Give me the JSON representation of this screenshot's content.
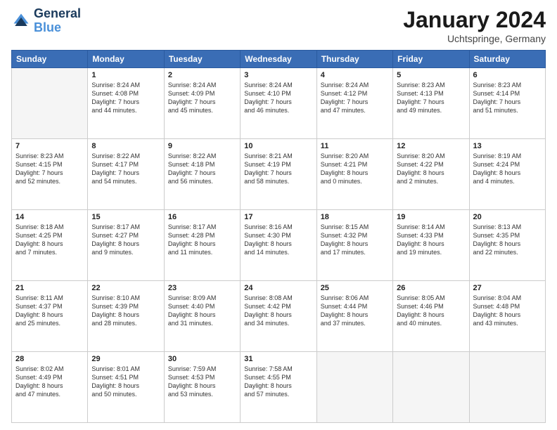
{
  "header": {
    "logo_line1": "General",
    "logo_line2": "Blue",
    "month_title": "January 2024",
    "location": "Uchtspringe, Germany"
  },
  "days_of_week": [
    "Sunday",
    "Monday",
    "Tuesday",
    "Wednesday",
    "Thursday",
    "Friday",
    "Saturday"
  ],
  "weeks": [
    [
      {
        "day": "",
        "info": ""
      },
      {
        "day": "1",
        "info": "Sunrise: 8:24 AM\nSunset: 4:08 PM\nDaylight: 7 hours\nand 44 minutes."
      },
      {
        "day": "2",
        "info": "Sunrise: 8:24 AM\nSunset: 4:09 PM\nDaylight: 7 hours\nand 45 minutes."
      },
      {
        "day": "3",
        "info": "Sunrise: 8:24 AM\nSunset: 4:10 PM\nDaylight: 7 hours\nand 46 minutes."
      },
      {
        "day": "4",
        "info": "Sunrise: 8:24 AM\nSunset: 4:12 PM\nDaylight: 7 hours\nand 47 minutes."
      },
      {
        "day": "5",
        "info": "Sunrise: 8:23 AM\nSunset: 4:13 PM\nDaylight: 7 hours\nand 49 minutes."
      },
      {
        "day": "6",
        "info": "Sunrise: 8:23 AM\nSunset: 4:14 PM\nDaylight: 7 hours\nand 51 minutes."
      }
    ],
    [
      {
        "day": "7",
        "info": "Sunrise: 8:23 AM\nSunset: 4:15 PM\nDaylight: 7 hours\nand 52 minutes."
      },
      {
        "day": "8",
        "info": "Sunrise: 8:22 AM\nSunset: 4:17 PM\nDaylight: 7 hours\nand 54 minutes."
      },
      {
        "day": "9",
        "info": "Sunrise: 8:22 AM\nSunset: 4:18 PM\nDaylight: 7 hours\nand 56 minutes."
      },
      {
        "day": "10",
        "info": "Sunrise: 8:21 AM\nSunset: 4:19 PM\nDaylight: 7 hours\nand 58 minutes."
      },
      {
        "day": "11",
        "info": "Sunrise: 8:20 AM\nSunset: 4:21 PM\nDaylight: 8 hours\nand 0 minutes."
      },
      {
        "day": "12",
        "info": "Sunrise: 8:20 AM\nSunset: 4:22 PM\nDaylight: 8 hours\nand 2 minutes."
      },
      {
        "day": "13",
        "info": "Sunrise: 8:19 AM\nSunset: 4:24 PM\nDaylight: 8 hours\nand 4 minutes."
      }
    ],
    [
      {
        "day": "14",
        "info": "Sunrise: 8:18 AM\nSunset: 4:25 PM\nDaylight: 8 hours\nand 7 minutes."
      },
      {
        "day": "15",
        "info": "Sunrise: 8:17 AM\nSunset: 4:27 PM\nDaylight: 8 hours\nand 9 minutes."
      },
      {
        "day": "16",
        "info": "Sunrise: 8:17 AM\nSunset: 4:28 PM\nDaylight: 8 hours\nand 11 minutes."
      },
      {
        "day": "17",
        "info": "Sunrise: 8:16 AM\nSunset: 4:30 PM\nDaylight: 8 hours\nand 14 minutes."
      },
      {
        "day": "18",
        "info": "Sunrise: 8:15 AM\nSunset: 4:32 PM\nDaylight: 8 hours\nand 17 minutes."
      },
      {
        "day": "19",
        "info": "Sunrise: 8:14 AM\nSunset: 4:33 PM\nDaylight: 8 hours\nand 19 minutes."
      },
      {
        "day": "20",
        "info": "Sunrise: 8:13 AM\nSunset: 4:35 PM\nDaylight: 8 hours\nand 22 minutes."
      }
    ],
    [
      {
        "day": "21",
        "info": "Sunrise: 8:11 AM\nSunset: 4:37 PM\nDaylight: 8 hours\nand 25 minutes."
      },
      {
        "day": "22",
        "info": "Sunrise: 8:10 AM\nSunset: 4:39 PM\nDaylight: 8 hours\nand 28 minutes."
      },
      {
        "day": "23",
        "info": "Sunrise: 8:09 AM\nSunset: 4:40 PM\nDaylight: 8 hours\nand 31 minutes."
      },
      {
        "day": "24",
        "info": "Sunrise: 8:08 AM\nSunset: 4:42 PM\nDaylight: 8 hours\nand 34 minutes."
      },
      {
        "day": "25",
        "info": "Sunrise: 8:06 AM\nSunset: 4:44 PM\nDaylight: 8 hours\nand 37 minutes."
      },
      {
        "day": "26",
        "info": "Sunrise: 8:05 AM\nSunset: 4:46 PM\nDaylight: 8 hours\nand 40 minutes."
      },
      {
        "day": "27",
        "info": "Sunrise: 8:04 AM\nSunset: 4:48 PM\nDaylight: 8 hours\nand 43 minutes."
      }
    ],
    [
      {
        "day": "28",
        "info": "Sunrise: 8:02 AM\nSunset: 4:49 PM\nDaylight: 8 hours\nand 47 minutes."
      },
      {
        "day": "29",
        "info": "Sunrise: 8:01 AM\nSunset: 4:51 PM\nDaylight: 8 hours\nand 50 minutes."
      },
      {
        "day": "30",
        "info": "Sunrise: 7:59 AM\nSunset: 4:53 PM\nDaylight: 8 hours\nand 53 minutes."
      },
      {
        "day": "31",
        "info": "Sunrise: 7:58 AM\nSunset: 4:55 PM\nDaylight: 8 hours\nand 57 minutes."
      },
      {
        "day": "",
        "info": ""
      },
      {
        "day": "",
        "info": ""
      },
      {
        "day": "",
        "info": ""
      }
    ]
  ]
}
